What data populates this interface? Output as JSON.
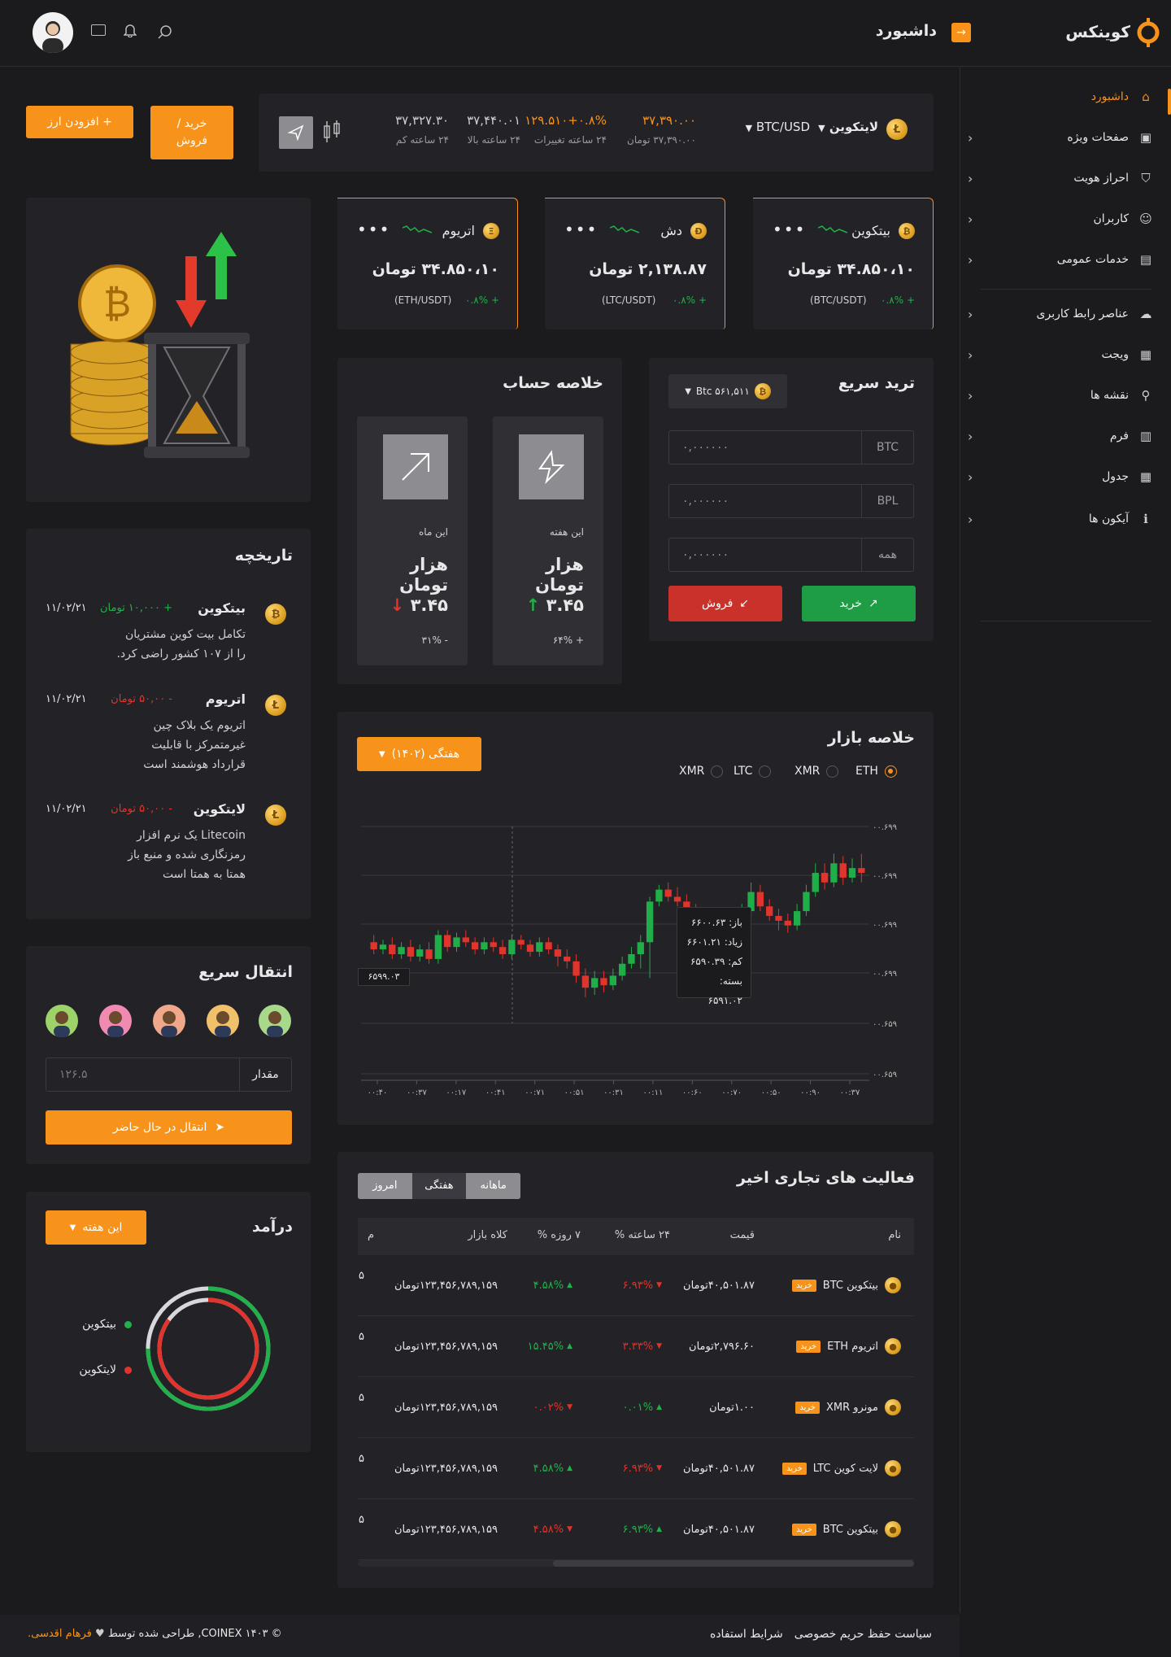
{
  "header": {
    "logo_text": "کوینکس",
    "page_title": "داشبورد",
    "icons": [
      "avatar",
      "mail-icon",
      "bell-icon",
      "search-icon"
    ]
  },
  "sidebar": {
    "items": [
      {
        "label": "داشبورد",
        "icon": "home-icon",
        "active": true
      },
      {
        "label": "صفحات ویژه",
        "icon": "camera-icon"
      },
      {
        "label": "احراز هویت",
        "icon": "shield-icon"
      },
      {
        "label": "کاربران",
        "icon": "user-icon"
      },
      {
        "label": "خدمات عمومی",
        "icon": "chat-icon"
      },
      {
        "label": "عناصر رابط کاربری",
        "icon": "cloud-icon"
      },
      {
        "label": "ویجت",
        "icon": "widget-icon"
      },
      {
        "label": "نقشه ها",
        "icon": "pin-icon"
      },
      {
        "label": "فرم",
        "icon": "form-icon"
      },
      {
        "label": "جدول",
        "icon": "table-icon"
      },
      {
        "label": "آیکون ها",
        "icon": "icon-icon"
      }
    ]
  },
  "ticker": {
    "coin": "لایتکوین",
    "pair": "BTC/USD",
    "price": "۳۷,۳۹۰.۰۰",
    "price_sub": "۳۷,۳۹۰.۰۰ تومان",
    "change": "۱۲۹.۵۱۰+۰.۸%",
    "change_sub": "۲۴ ساعته تغییرات",
    "high": "۳۷,۴۴۰.۰۱",
    "high_sub": "۲۴ ساعته بالا",
    "low": "۳۷,۳۲۷.۳۰",
    "low_sub": "۲۴ ساعته کم",
    "buy_sell_label": "خرید / فروش",
    "add_currency_label": "+ افزودن ارز"
  },
  "coin_cards": [
    {
      "name": "بیتکوین",
      "amount": "۳۴.۸۵۰،۱۰ تومان",
      "pair": "(BTC/USDT)",
      "change": "+ ۰.۸%"
    },
    {
      "name": "دش",
      "amount": "۲,۱۳۸.۸۷ تومان",
      "pair": "(LTC/USDT)",
      "change": "+ ۰.۸%"
    },
    {
      "name": "اتریوم",
      "amount": "۳۴.۸۵۰،۱۰ تومان",
      "pair": "(ETH/USDT)",
      "change": "+ ۰.۸%"
    }
  ],
  "quick_trade": {
    "title": "ترید سریع",
    "balance": "Btc ۵۶۱,۵۱۱",
    "inputs": [
      {
        "currency": "BTC",
        "value": "۰,۰۰۰۰۰۰"
      },
      {
        "currency": "BPL",
        "value": "۰,۰۰۰۰۰۰"
      },
      {
        "currency": "همه",
        "value": "۰,۰۰۰۰۰۰"
      }
    ],
    "buy_label": "خرید",
    "sell_label": "فروش"
  },
  "account_summary": {
    "title": "خلاصه حساب",
    "week": {
      "period": "این هفته",
      "amount": "هزار تومان ۳.۴۵",
      "change": "+ ۶۴%"
    },
    "month": {
      "period": "این ماه",
      "amount": "هزار تومان ۳.۴۵",
      "change": "- ۳۱%"
    }
  },
  "market_summary": {
    "title": "خلاصه بازار",
    "dropdown": "هفتگی (۱۴۰۲)",
    "radios": [
      "ETH",
      "XMR",
      "LTC",
      "XMR"
    ],
    "tooltip": {
      "open": "باز: ۶۶۰۰.۶۳",
      "high": "زیاد: ۶۶۰۱.۲۱",
      "low": "کم: ۶۵۹۰.۳۹",
      "close": "بسته: ۶۵۹۱.۰۲"
    },
    "price_marker": "۶۵۹۹.۰۳"
  },
  "chart_data": {
    "type": "candlestick",
    "y_ticks": [
      "۰۰.۶۹۹",
      "۰۰.۶۹۹",
      "۰۰.۶۹۹",
      "۰۰.۶۹۹",
      "۰۰.۶۵۹",
      "۰۰.۶۵۹"
    ],
    "x_ticks": [
      "۰۰:۴۰",
      "۰۰:۳۷",
      "۰۰:۱۷",
      "۰۰:۴۱",
      "۰۰:۷۱",
      "۰۰:۵۱",
      "۰۰:۳۱",
      "۰۰:۱۱",
      "۰۰:۶۰",
      "۰۰:۷۰",
      "۰۰:۵۰",
      "۰۰:۹۰",
      "۰۰:۳۷"
    ],
    "candles": [
      [
        0.55,
        0.52,
        0.58,
        0.5
      ],
      [
        0.52,
        0.54,
        0.56,
        0.5
      ],
      [
        0.54,
        0.5,
        0.57,
        0.48
      ],
      [
        0.5,
        0.53,
        0.55,
        0.48
      ],
      [
        0.53,
        0.49,
        0.56,
        0.47
      ],
      [
        0.49,
        0.52,
        0.54,
        0.47
      ],
      [
        0.52,
        0.48,
        0.55,
        0.46
      ],
      [
        0.48,
        0.58,
        0.6,
        0.46
      ],
      [
        0.58,
        0.53,
        0.6,
        0.51
      ],
      [
        0.53,
        0.57,
        0.59,
        0.51
      ],
      [
        0.57,
        0.55,
        0.6,
        0.53
      ],
      [
        0.55,
        0.52,
        0.57,
        0.5
      ],
      [
        0.52,
        0.55,
        0.57,
        0.5
      ],
      [
        0.55,
        0.53,
        0.57,
        0.51
      ],
      [
        0.53,
        0.5,
        0.56,
        0.48
      ],
      [
        0.5,
        0.56,
        0.58,
        0.48
      ],
      [
        0.56,
        0.54,
        0.58,
        0.52
      ],
      [
        0.54,
        0.51,
        0.56,
        0.49
      ],
      [
        0.51,
        0.55,
        0.57,
        0.49
      ],
      [
        0.55,
        0.52,
        0.57,
        0.5
      ],
      [
        0.52,
        0.49,
        0.54,
        0.45
      ],
      [
        0.49,
        0.47,
        0.52,
        0.44
      ],
      [
        0.47,
        0.41,
        0.5,
        0.38
      ],
      [
        0.41,
        0.36,
        0.44,
        0.32
      ],
      [
        0.36,
        0.4,
        0.43,
        0.33
      ],
      [
        0.4,
        0.37,
        0.43,
        0.34
      ],
      [
        0.37,
        0.41,
        0.44,
        0.35
      ],
      [
        0.41,
        0.46,
        0.49,
        0.39
      ],
      [
        0.46,
        0.5,
        0.53,
        0.44
      ],
      [
        0.5,
        0.55,
        0.58,
        0.44
      ],
      [
        0.55,
        0.72,
        0.74,
        0.4
      ],
      [
        0.72,
        0.77,
        0.79,
        0.7
      ],
      [
        0.77,
        0.74,
        0.8,
        0.72
      ],
      [
        0.74,
        0.72,
        0.78,
        0.7
      ],
      [
        0.72,
        0.68,
        0.75,
        0.65
      ],
      [
        0.68,
        0.64,
        0.71,
        0.61
      ],
      [
        0.64,
        0.62,
        0.67,
        0.59
      ],
      [
        0.62,
        0.58,
        0.65,
        0.56
      ],
      [
        0.58,
        0.62,
        0.65,
        0.56
      ],
      [
        0.62,
        0.6,
        0.64,
        0.57
      ],
      [
        0.6,
        0.68,
        0.71,
        0.58
      ],
      [
        0.68,
        0.76,
        0.8,
        0.66
      ],
      [
        0.76,
        0.7,
        0.79,
        0.68
      ],
      [
        0.7,
        0.66,
        0.73,
        0.64
      ],
      [
        0.66,
        0.64,
        0.69,
        0.6
      ],
      [
        0.64,
        0.62,
        0.67,
        0.59
      ],
      [
        0.62,
        0.68,
        0.71,
        0.6
      ],
      [
        0.68,
        0.76,
        0.79,
        0.66
      ],
      [
        0.76,
        0.84,
        0.88,
        0.74
      ],
      [
        0.84,
        0.8,
        0.88,
        0.77
      ],
      [
        0.8,
        0.88,
        0.92,
        0.78
      ],
      [
        0.88,
        0.82,
        0.91,
        0.79
      ],
      [
        0.82,
        0.86,
        0.9,
        0.8
      ],
      [
        0.86,
        0.84,
        0.92,
        0.8
      ]
    ]
  },
  "recent_activity": {
    "title": "فعالیت های تجاری اخیر",
    "tabs": [
      "ماهانه",
      "هفتگی",
      "امروز"
    ],
    "columns": [
      "نام",
      "قیمت",
      "۲۴ ساعته %",
      "۷ روزه %",
      "کلاه بازار",
      "م"
    ],
    "rows": [
      {
        "name": "بیتکوین BTC",
        "tag": "خرید",
        "price": "۴۰,۵۰۱.۸۷تومان",
        "d1": "۶.۹۳%",
        "d1_dir": "down",
        "d7": "۴.۵۸%",
        "d7_dir": "up",
        "cap": "۱۲۳,۴۵۶,۷۸۹,۱۵۹تومان",
        "extra": "۵"
      },
      {
        "name": "اتریوم ETH",
        "tag": "خرید",
        "price": "۲,۷۹۶.۶۰تومان",
        "d1": "۳.۳۳%",
        "d1_dir": "down",
        "d7": "۱۵.۴۵%",
        "d7_dir": "up",
        "cap": "۱۲۳,۴۵۶,۷۸۹,۱۵۹تومان",
        "extra": "۵"
      },
      {
        "name": "مونرو XMR",
        "tag": "خرید",
        "price": "۱.۰۰تومان",
        "d1": "۰.۰۱%",
        "d1_dir": "up",
        "d7": "۰.۰۲%",
        "d7_dir": "down",
        "cap": "۱۲۳,۴۵۶,۷۸۹,۱۵۹تومان",
        "extra": "۵"
      },
      {
        "name": "لایت کوین LTC",
        "tag": "خرید",
        "price": "۴۰,۵۰۱.۸۷تومان",
        "d1": "۶.۹۳%",
        "d1_dir": "down",
        "d7": "۴.۵۸%",
        "d7_dir": "up",
        "cap": "۱۲۳,۴۵۶,۷۸۹,۱۵۹تومان",
        "extra": "۵"
      },
      {
        "name": "بیتکوین BTC",
        "tag": "خرید",
        "price": "۴۰,۵۰۱.۸۷تومان",
        "d1": "۶.۹۳%",
        "d1_dir": "up",
        "d7": "۴.۵۸%",
        "d7_dir": "down",
        "cap": "۱۲۳,۴۵۶,۷۸۹,۱۵۹تومان",
        "extra": "۵"
      }
    ]
  },
  "history": {
    "title": "تاریخچه",
    "items": [
      {
        "coin": "بیتکوین",
        "amount": "+ ۱۰,۰۰۰ تومان",
        "dir": "up",
        "date": "۱۱/۰۲/۲۱",
        "desc": "تکامل بیت کوین مشتریان را از ۱۰۷ کشور راضی کرد."
      },
      {
        "coin": "اتریوم",
        "amount": "- ۵۰,۰۰ تومان",
        "dir": "down",
        "date": "۱۱/۰۲/۲۱",
        "desc": "اتریوم یک بلاک چین غیرمتمرکز با قابلیت قرارداد هوشمند است"
      },
      {
        "coin": "لایتکوین",
        "amount": "- ۵۰,۰۰ تومان",
        "dir": "down",
        "date": "۱۱/۰۲/۲۱",
        "desc": "Litecoin یک نرم افزار رمزنگاری شده و منبع باز همتا به همتا است"
      }
    ]
  },
  "quick_transfer": {
    "title": "انتقال سریع",
    "amount_label": "مقدار",
    "amount_value": "۱۲۶.۵",
    "button": "انتقال در حال حاضر"
  },
  "income": {
    "title": "درآمد",
    "dropdown": "این هفته",
    "legend": [
      {
        "label": "بیتکوین",
        "color": "#22b04b"
      },
      {
        "label": "لایتکوین",
        "color": "#e0342c"
      }
    ],
    "donut": {
      "outer_fraction": 0.75,
      "inner_fraction": 0.85
    }
  },
  "footer": {
    "links": [
      "سیاست حفظ حریم خصوصی",
      "شرایط استفاده"
    ],
    "copyright": "© COINEX ۱۴۰۳, طراحی شده توسط",
    "author": "فرهام اقدسی."
  }
}
